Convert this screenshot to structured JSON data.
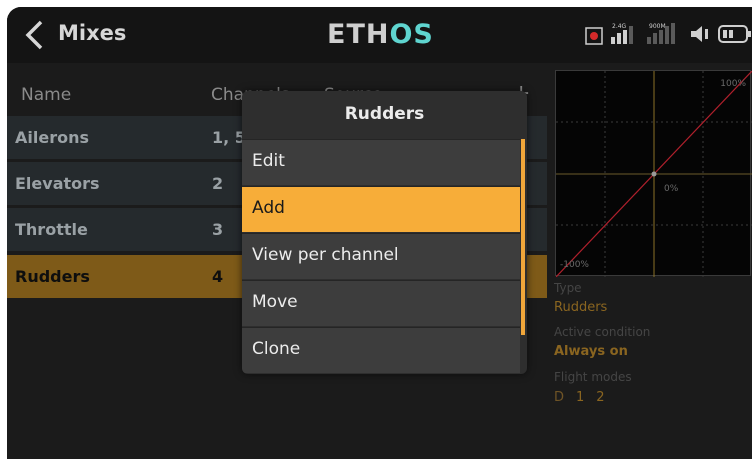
{
  "header": {
    "title": "Mixes",
    "logo": {
      "part1": "ETH",
      "part2": "OS"
    },
    "status_icons": {
      "rf_bar": "2.4G",
      "rf_900": "900M",
      "icons": [
        "record-icon",
        "signal-2g4-icon",
        "signal-900m-icon",
        "speaker-icon",
        "battery-icon"
      ]
    }
  },
  "columns": {
    "name": "Name",
    "channels": "Channels",
    "source": "Source"
  },
  "add_symbol": "+",
  "rows": [
    {
      "name": "Ailerons",
      "channels": "1, 5"
    },
    {
      "name": "Elevators",
      "channels": "2"
    },
    {
      "name": "Throttle",
      "channels": "3"
    },
    {
      "name": "Rudders",
      "channels": "4"
    }
  ],
  "selected_row": 3,
  "graph": {
    "top_label": "100%",
    "mid_label": "0%",
    "bottom_label": "-100%"
  },
  "details": {
    "type_label": "Type",
    "type_value": "Rudders",
    "condition_label": "Active condition",
    "condition_value": "Always on",
    "flight_modes_label": "Flight modes",
    "flight_modes": [
      "D",
      "1",
      "2"
    ]
  },
  "popup": {
    "title": "Rudders",
    "items": [
      "Edit",
      "Add",
      "View per channel",
      "Move",
      "Clone"
    ],
    "selected_index": 1
  },
  "colors": {
    "accent": "#f7ad39",
    "selected_row": "#7e5a18",
    "row_bg": "#252a2d",
    "logo_accent": "#5fd5d0"
  }
}
